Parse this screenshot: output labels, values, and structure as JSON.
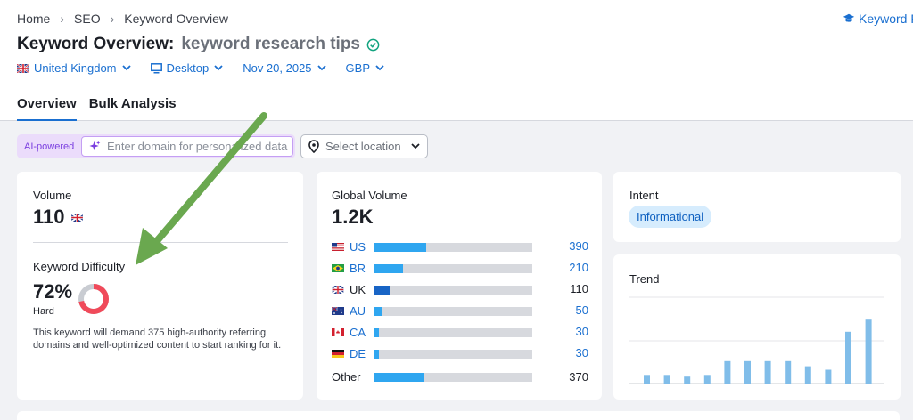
{
  "breadcrumb": {
    "items": [
      "Home",
      "SEO",
      "Keyword Overview"
    ]
  },
  "header_link": {
    "label": "Keyword R"
  },
  "page": {
    "title_prefix": "Keyword Overview:",
    "keyword": "keyword research tips"
  },
  "filters": {
    "database": "United Kingdom",
    "device": "Desktop",
    "date": "Nov 20, 2025",
    "currency": "GBP"
  },
  "tabs": [
    {
      "label": "Overview",
      "active": true
    },
    {
      "label": "Bulk Analysis",
      "active": false
    }
  ],
  "ai": {
    "badge": "AI-powered",
    "placeholder": "Enter domain for personalized data"
  },
  "location": {
    "placeholder": "Select location"
  },
  "volume": {
    "label": "Volume",
    "value": "110"
  },
  "keyword_difficulty": {
    "label": "Keyword Difficulty",
    "value": "72%",
    "percent": 72,
    "grade": "Hard",
    "description": "This keyword will demand 375 high-authority referring domains and well-optimized content to start ranking for it."
  },
  "global_volume": {
    "label": "Global Volume",
    "value": "1.2K",
    "rows": [
      {
        "code": "US",
        "value": "390",
        "fraction": 0.33
      },
      {
        "code": "BR",
        "value": "210",
        "fraction": 0.18
      },
      {
        "code": "UK",
        "value": "110",
        "fraction": 0.095
      },
      {
        "code": "AU",
        "value": "50",
        "fraction": 0.045
      },
      {
        "code": "CA",
        "value": "30",
        "fraction": 0.03
      },
      {
        "code": "DE",
        "value": "30",
        "fraction": 0.03
      }
    ],
    "other": {
      "label": "Other",
      "value": "370",
      "fraction": 0.31
    }
  },
  "intent": {
    "label": "Intent",
    "value": "Informational"
  },
  "trend": {
    "label": "Trend",
    "values": [
      10,
      10,
      8,
      10,
      26,
      26,
      26,
      26,
      20,
      16,
      60,
      74
    ],
    "max": 100
  },
  "colors": {
    "accent": "#1a6fd0",
    "bar": "#2fa6f0",
    "bar_uk": "#1864c5",
    "kd_red": "#f04a5a",
    "arrow": "#6aa84f"
  }
}
